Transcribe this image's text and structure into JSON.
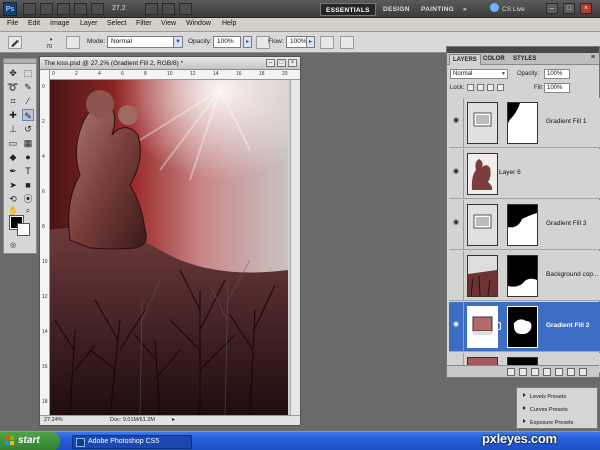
{
  "app": {
    "logo": "Ps",
    "zoom": "27.2",
    "workspaces": [
      "ESSENTIALS",
      "DESIGN",
      "PAINTING",
      "»"
    ],
    "cs_live": "CS Live",
    "window_buttons": [
      "–",
      "□",
      "×"
    ]
  },
  "menu": [
    "File",
    "Edit",
    "Image",
    "Layer",
    "Select",
    "Filter",
    "View",
    "Window",
    "Help"
  ],
  "options": {
    "brush_size": "70",
    "mode_label": "Mode:",
    "mode_value": "Normal",
    "opacity_label": "Opacity:",
    "opacity_value": "100%",
    "flow_label": "Flow:",
    "flow_value": "100%"
  },
  "document": {
    "title": "The kiss.psd @ 27.2% (Gradient Fill 2, RGB/8) *",
    "zoom": "27.24%",
    "doc_info": "Doc: 9.01M/61.2M",
    "ruler_top": [
      "0",
      "2",
      "4",
      "6",
      "8",
      "10",
      "12",
      "14",
      "16",
      "18",
      "20"
    ],
    "ruler_left": [
      "0",
      "2",
      "4",
      "6",
      "8",
      "10",
      "12",
      "14",
      "16",
      "18"
    ]
  },
  "layers_panel": {
    "tabs": [
      "LAYERS",
      "COLOR",
      "STYLES"
    ],
    "blend_mode": "Normal",
    "opacity_label": "Opacity:",
    "opacity_value": "100%",
    "lock_label": "Lock:",
    "fill_label": "Fill:",
    "fill_value": "100%",
    "layers": [
      {
        "name": "Gradient Fill 1",
        "selected": false
      },
      {
        "name": "Layer 6",
        "selected": false
      },
      {
        "name": "Gradient Fill 3",
        "selected": false
      },
      {
        "name": "Background cop...",
        "selected": false
      },
      {
        "name": "Gradient Fill 2",
        "selected": true
      },
      {
        "name": "",
        "selected": false
      }
    ]
  },
  "presets": [
    "Levels Presets",
    "Curves Presets",
    "Exposure Presets"
  ],
  "taskbar": {
    "start": "start",
    "task": "Adobe Photoshop CS5"
  },
  "watermark": "pxleyes.com"
}
